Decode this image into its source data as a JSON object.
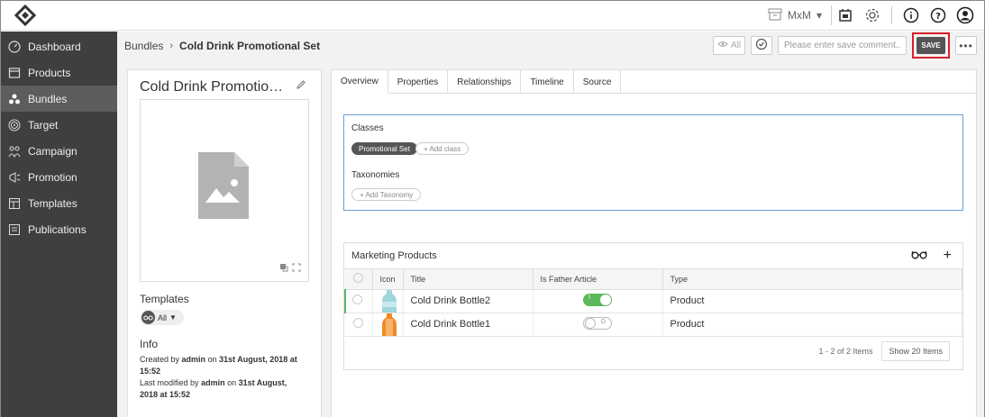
{
  "topbar": {
    "org_label": "MxM"
  },
  "sidebar": {
    "items": [
      {
        "label": "Dashboard",
        "icon": "dashboard-icon"
      },
      {
        "label": "Products",
        "icon": "products-icon"
      },
      {
        "label": "Bundles",
        "icon": "bundles-icon",
        "active": true
      },
      {
        "label": "Target",
        "icon": "target-icon"
      },
      {
        "label": "Campaign",
        "icon": "campaign-icon"
      },
      {
        "label": "Promotion",
        "icon": "promotion-icon"
      },
      {
        "label": "Templates",
        "icon": "templates-icon"
      },
      {
        "label": "Publications",
        "icon": "publications-icon"
      }
    ]
  },
  "header": {
    "breadcrumb_parent": "Bundles",
    "breadcrumb_current": "Cold Drink Promotional Set",
    "all_label": "All",
    "comment_placeholder": "Please enter save comment...",
    "save_label": "SAVE",
    "more_label": "•••"
  },
  "left": {
    "title": "Cold Drink Promotiona...",
    "templates_label": "Templates",
    "templates_value": "All",
    "info_label": "Info",
    "created_prefix": "Created by",
    "created_user": "admin",
    "created_on": "on",
    "created_date": "31st August, 2018 at 15:52",
    "modified_prefix": "Last modified by",
    "modified_user": "admin",
    "modified_on": "on",
    "modified_date_1": "31st August,",
    "modified_date_2": "2018 at 15:52"
  },
  "tabs": [
    "Overview",
    "Properties",
    "Relationships",
    "Timeline",
    "Source"
  ],
  "overview": {
    "classes_label": "Classes",
    "class_chip": "Promotional Set",
    "add_class": "+ Add class",
    "taxonomies_label": "Taxonomies",
    "add_taxonomy": "+ Add Taxonomy"
  },
  "marketing": {
    "title": "Marketing Products",
    "columns": [
      "Icon",
      "Title",
      "Is Father Article",
      "Type"
    ],
    "rows": [
      {
        "title": "Cold Drink Bottle2",
        "father": true,
        "toggle_label": "I",
        "type": "Product",
        "bottle_color": "#9ed6da"
      },
      {
        "title": "Cold Drink Bottle1",
        "father": false,
        "toggle_label": "O",
        "type": "Product",
        "bottle_color": "#f08a24"
      }
    ],
    "count": "1 - 2 of 2 Items",
    "show_label": "Show 20 Items"
  }
}
